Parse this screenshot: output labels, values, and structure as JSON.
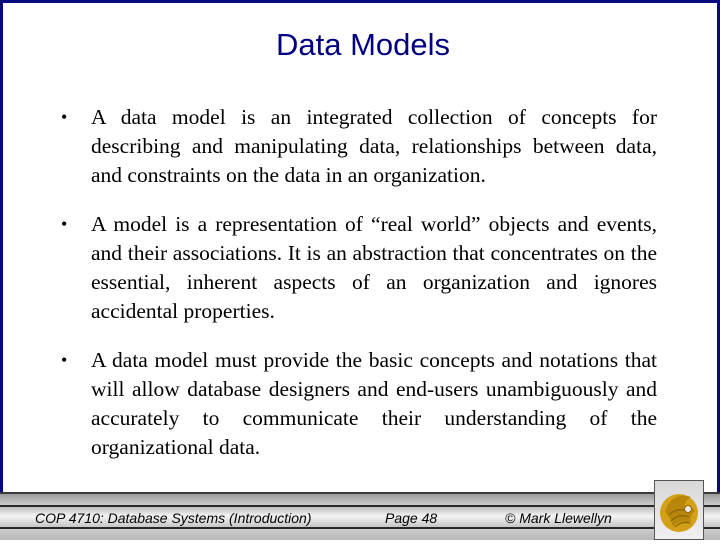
{
  "slide": {
    "title": "Data Models",
    "bullets": [
      "A data model is an integrated collection of concepts for describing and manipulating data, relationships between data, and constraints on the data in an organization.",
      "A model is a representation of “real world” objects and events, and their associations.  It is an abstraction that concentrates on the essential, inherent aspects of an organization and ignores accidental properties.",
      "A data model must provide the basic concepts and notations that will allow database designers and end-users unambiguously and accurately to communicate their understanding of the organizational data."
    ],
    "bullet_glyph": "•"
  },
  "footer": {
    "course": "COP 4710: Database Systems  (Introduction)",
    "page": "Page 48",
    "copyright": "© Mark Llewellyn",
    "logo": "ucf-pegasus-logo"
  },
  "colors": {
    "title": "#000080",
    "frame_border": "#0a0a80",
    "logo_gold": "#d4a017"
  }
}
